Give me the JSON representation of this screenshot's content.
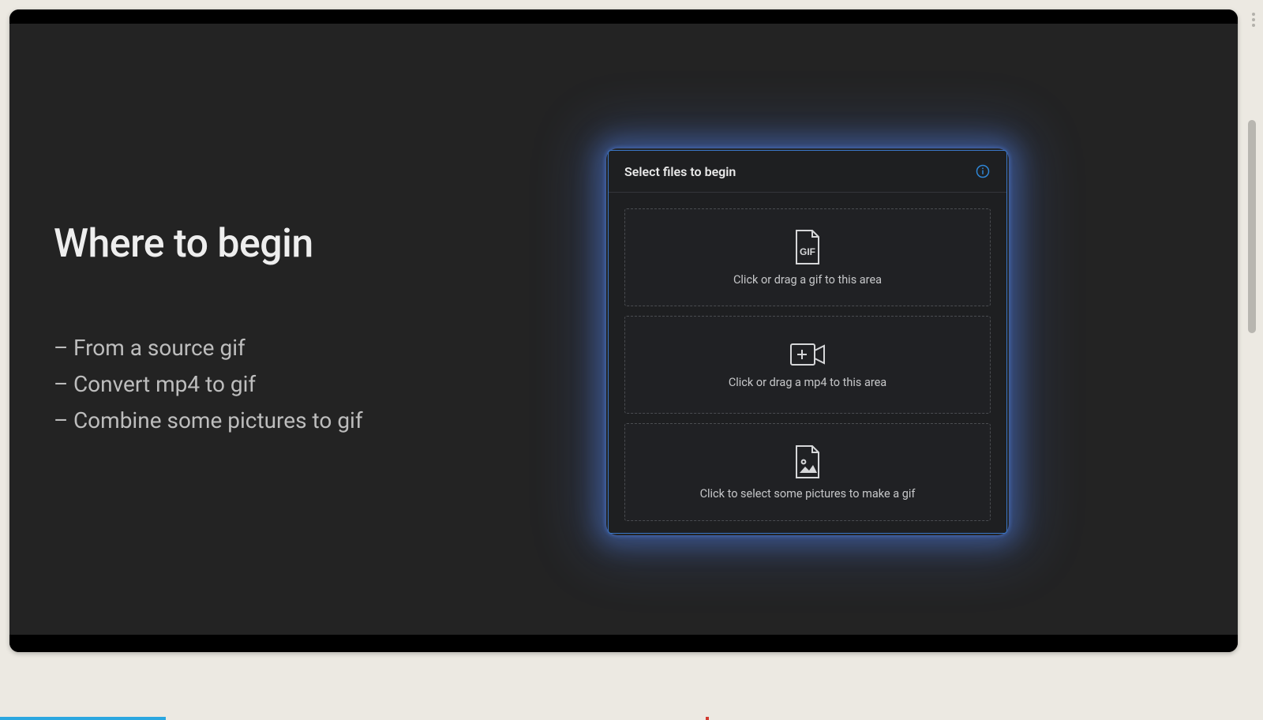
{
  "heading": "Where to begin",
  "bullets": {
    "dash": "–",
    "items": [
      "From a source gif",
      "Convert mp4 to gif",
      "Combine some pictures to gif"
    ]
  },
  "panel": {
    "title": "Select files to begin",
    "info_icon": "info",
    "dropzones": [
      {
        "icon": "gif",
        "label": "Click or drag a gif to this area"
      },
      {
        "icon": "video",
        "label": "Click or drag a mp4 to this area"
      },
      {
        "icon": "image",
        "label": "Click to select some pictures to make a gif"
      }
    ]
  },
  "colors": {
    "accent": "#3a77c8",
    "info": "#2f86d6",
    "glow": "#568cff"
  }
}
